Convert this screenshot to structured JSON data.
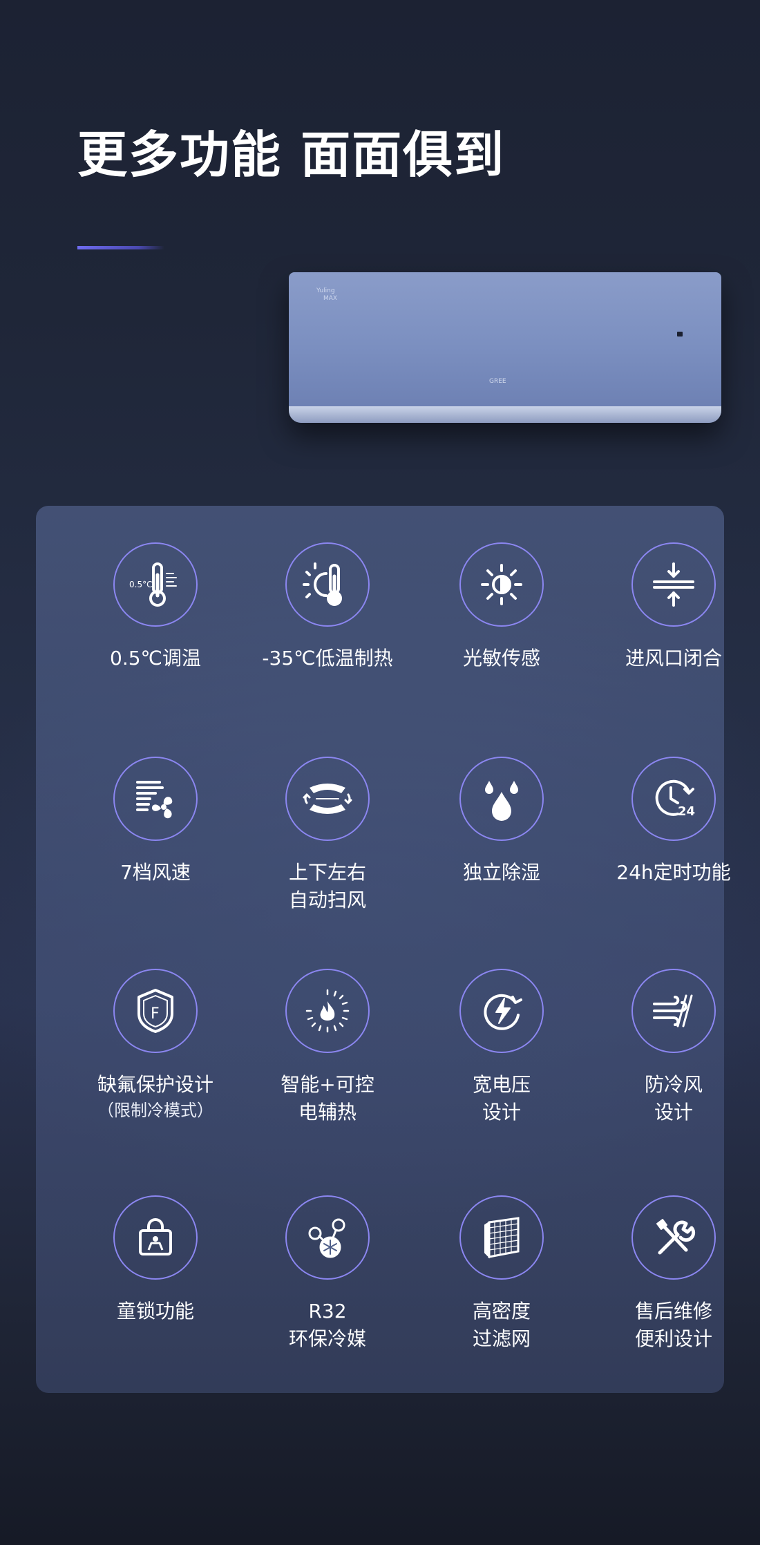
{
  "header": {
    "title": "更多功能 面面俱到"
  },
  "product": {
    "badge_line1": "Yuling",
    "badge_line2": "MAX",
    "brand": "GREE"
  },
  "features": [
    {
      "icon": "thermometer-0.5-icon",
      "icon_text": "0.5°C",
      "label1": "0.5℃调温",
      "label2": ""
    },
    {
      "icon": "sun-thermometer-icon",
      "label1": "-35℃低温制热",
      "label2": ""
    },
    {
      "icon": "light-sensor-icon",
      "label1": "光敏传感",
      "label2": ""
    },
    {
      "icon": "air-inlet-close-icon",
      "label1": "进风口闭合",
      "label2": ""
    },
    {
      "icon": "fan-speed-icon",
      "label1": "7档风速",
      "label2": ""
    },
    {
      "icon": "swing-icon",
      "label1": "上下左右",
      "label2": "自动扫风"
    },
    {
      "icon": "dehumidify-icon",
      "label1": "独立除湿",
      "label2": ""
    },
    {
      "icon": "timer-24h-icon",
      "icon_text": "24",
      "label1": "24h定时功能",
      "label2": ""
    },
    {
      "icon": "freon-shield-icon",
      "icon_text": "F",
      "label1": "缺氟保护设计",
      "label2": "（限制冷模式）"
    },
    {
      "icon": "electric-heat-icon",
      "label1": "智能+可控",
      "label2": "电辅热"
    },
    {
      "icon": "wide-voltage-icon",
      "label1": "宽电压",
      "label2": "设计"
    },
    {
      "icon": "anti-cold-wind-icon",
      "label1": "防冷风",
      "label2": "设计"
    },
    {
      "icon": "child-lock-icon",
      "label1": "童锁功能",
      "label2": ""
    },
    {
      "icon": "r32-refrigerant-icon",
      "label1": "R32",
      "label2": "环保冷媒"
    },
    {
      "icon": "filter-mesh-icon",
      "label1": "高密度",
      "label2": "过滤网"
    },
    {
      "icon": "repair-tools-icon",
      "label1": "售后维修",
      "label2": "便利设计"
    }
  ],
  "colors": {
    "accent": "#8b86f0",
    "panel": "#4f5f8a"
  }
}
